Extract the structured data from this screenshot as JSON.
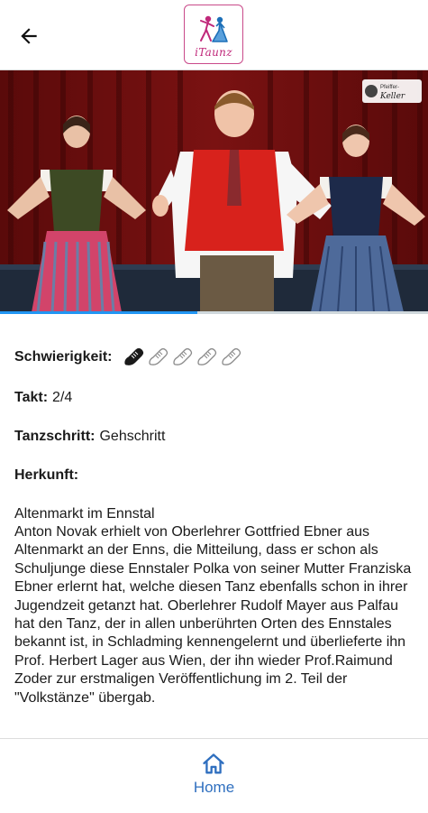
{
  "header": {
    "back_icon": "arrow-left-icon",
    "logo_text": "iTaunz"
  },
  "hero": {
    "watermark_text": "Pfeiffer-Keller",
    "progress_fraction": 0.46
  },
  "details": {
    "difficulty_label": "Schwierigkeit:",
    "difficulty_rating": 1,
    "difficulty_max": 5,
    "difficulty_icon": "dance-shoe-icon",
    "takt_label": "Takt:",
    "takt_value": "2/4",
    "tanzschritt_label": "Tanzschritt:",
    "tanzschritt_value": "Gehschritt",
    "herkunft_label": "Herkunft:",
    "herkunft_value": "Altenmarkt im Ennstal",
    "description": "Anton Novak erhielt von Oberlehrer Gottfried Ebner aus Altenmarkt an der Enns, die Mitteilung, dass er schon als Schuljunge diese Ennstaler Polka von seiner Mutter Franziska Ebner erlernt hat, welche diesen Tanz ebenfalls schon in ihrer Jugendzeit getanzt hat. Oberlehrer Rudolf Mayer aus Palfau hat den Tanz, der in allen unberührten Orten des Ennstales bekannt ist, in Schladming kennengelernt und überlieferte ihn Prof. Herbert Lager aus Wien, der ihn wieder Prof.Raimund Zoder zur erstmaligen Veröffentlichung im 2. Teil der \"Volkstänze\" übergab."
  },
  "bottom_nav": {
    "home_label": "Home",
    "home_icon": "home-icon",
    "accent_color": "#2f6fbf"
  }
}
